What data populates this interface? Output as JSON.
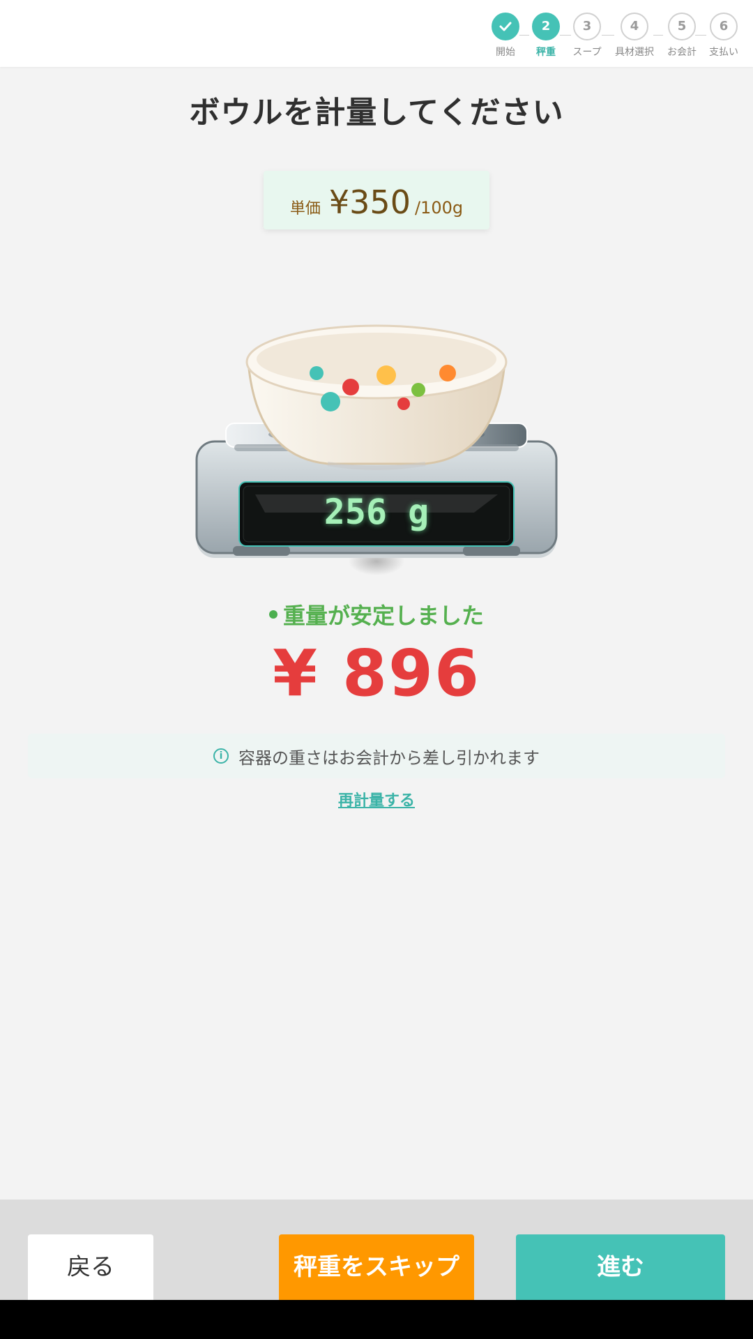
{
  "stepper": {
    "steps": [
      {
        "number": "",
        "label": "開始",
        "state": "done"
      },
      {
        "number": "2",
        "label": "秤重",
        "state": "active"
      },
      {
        "number": "3",
        "label": "スープ",
        "state": "pending"
      },
      {
        "number": "4",
        "label": "具材選択",
        "state": "pending"
      },
      {
        "number": "5",
        "label": "お会計",
        "state": "pending"
      },
      {
        "number": "6",
        "label": "支払い",
        "state": "pending"
      }
    ],
    "done_icon": "check-icon"
  },
  "main": {
    "title": "ボウルを計量してください",
    "unit_price": {
      "label": "単価",
      "value": "¥350",
      "per": "/100g"
    },
    "scale_display": "256 g",
    "status": "重量が安定しました",
    "price": "¥ 896",
    "note": "容器の重さはお会計から差し引かれます",
    "reweigh_link": "再計量する"
  },
  "footer": {
    "back_label": "戻る",
    "skip_label": "秤重をスキップ",
    "next_label": "進む"
  },
  "colors": {
    "accent": "#45c2b6",
    "skip": "#ff9800",
    "price": "#e53d3d",
    "status": "#55b04f"
  }
}
